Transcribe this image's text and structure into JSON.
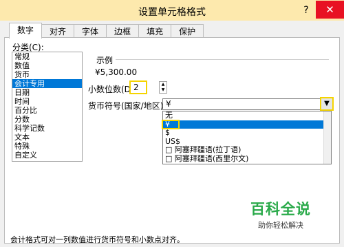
{
  "dialog": {
    "title": "设置单元格格式",
    "help_label": "?",
    "close_label": "✕"
  },
  "tabs": [
    {
      "label": "数字",
      "active": true
    },
    {
      "label": "对齐",
      "active": false
    },
    {
      "label": "字体",
      "active": false
    },
    {
      "label": "边框",
      "active": false
    },
    {
      "label": "填充",
      "active": false
    },
    {
      "label": "保护",
      "active": false
    }
  ],
  "category": {
    "label": "分类(C):",
    "items": [
      "常规",
      "数值",
      "货币",
      "会计专用",
      "日期",
      "时间",
      "百分比",
      "分数",
      "科学记数",
      "文本",
      "特殊",
      "自定义"
    ],
    "selected_index": 3
  },
  "sample": {
    "label": "示例",
    "value": "¥5,300.00"
  },
  "decimal": {
    "label": "小数位数(D):",
    "value": "2"
  },
  "currency": {
    "label": "货币符号(国家/地区)(S):",
    "value": "¥",
    "options": [
      "无",
      "¥",
      "$",
      "US$",
      "□ 阿塞拜疆语(拉丁语)",
      "□ 阿塞拜疆语(西里尔文)"
    ],
    "highlighted_index": 1
  },
  "watermark": {
    "main": "百科全说",
    "sub": "助你轻松解决"
  },
  "description": "会计格式可对一列数值进行货币符号和小数点对齐。",
  "colors": {
    "title_bar": "#fde9ad",
    "close": "#e81123",
    "selection": "#0078d7",
    "highlight_border": "#f5d400",
    "watermark": "#2aaa4a"
  },
  "icons": {
    "spin_up": "triangle-up",
    "spin_down": "triangle-down",
    "dropdown": "chevron-down"
  }
}
